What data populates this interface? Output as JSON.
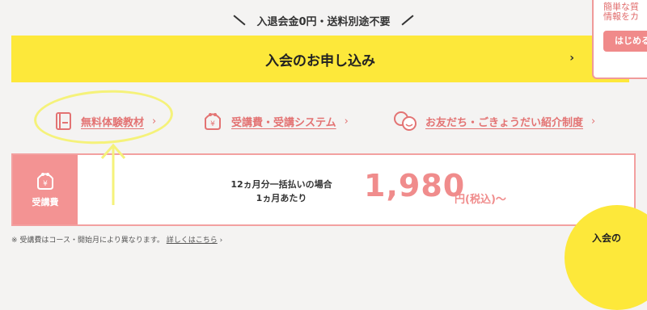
{
  "top_banner": {
    "text": "入退会金0円・送料別途不要"
  },
  "apply_button": {
    "label": "入会のお申し込み",
    "chevron": "›"
  },
  "promo_card": {
    "line1": "簡単な質",
    "line2": "情報をカ",
    "button_label": "はじめる"
  },
  "links": [
    {
      "label": "無料体験教材",
      "icon": "book-icon",
      "chevron": "›"
    },
    {
      "label": "受講費・受講システム",
      "icon": "wallet-icon",
      "chevron": "›"
    },
    {
      "label": "お友だち・ごきょうだい紹介制度",
      "icon": "smile-friends-icon",
      "chevron": "›"
    }
  ],
  "fee_panel": {
    "tag_label": "受講費",
    "desc_line1": "12ヵ月分一括払いの場合",
    "desc_line2": "1ヵ月あたり",
    "price": "1,980",
    "unit": "円(税込)〜"
  },
  "note": {
    "text": "※ 受講費はコース・開始月により異なります。",
    "more_link": "詳しくはこちら",
    "chevron": "›"
  },
  "circle_cta": {
    "text": "入会の"
  },
  "colors": {
    "yellow": "#fde83a",
    "pink": "#f08c8c",
    "link_pink": "#e37373",
    "annotation_yellow": "#f5f27a"
  }
}
